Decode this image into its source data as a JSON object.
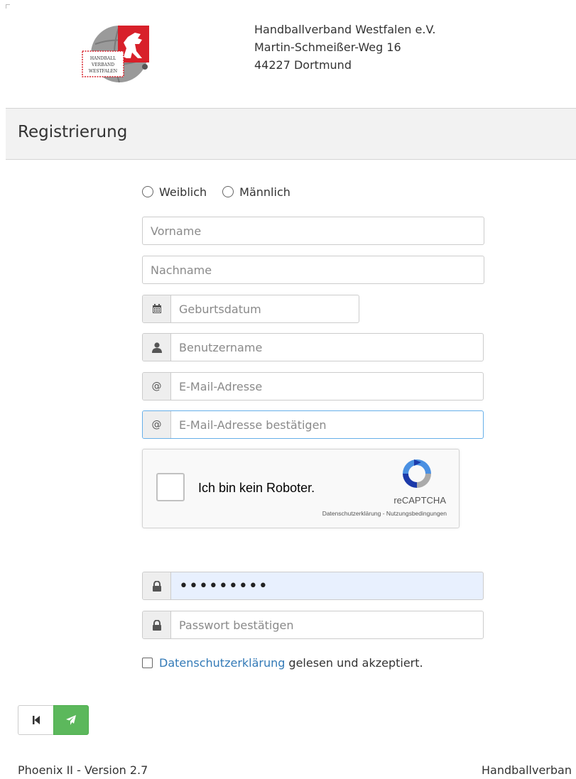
{
  "header": {
    "logo_text": [
      "HANDBALL",
      "VERBAND",
      "WESTFALEN"
    ],
    "address_lines": [
      "Handballverband Westfalen e.V.",
      "Martin-Schmeißer-Weg 16",
      "44227 Dortmund"
    ]
  },
  "page_title": "Registrierung",
  "gender": {
    "options": [
      "Weiblich",
      "Männlich"
    ]
  },
  "fields": {
    "first_name": {
      "placeholder": "Vorname"
    },
    "last_name": {
      "placeholder": "Nachname"
    },
    "birthdate": {
      "placeholder": "Geburtsdatum",
      "icon": "calendar-icon"
    },
    "username": {
      "placeholder": "Benutzername",
      "icon": "user-icon"
    },
    "email": {
      "placeholder": "E-Mail-Adresse",
      "icon_text": "@"
    },
    "email_confirm": {
      "placeholder": "E-Mail-Adresse bestätigen",
      "icon_text": "@"
    },
    "password": {
      "value": "•••••••••",
      "icon": "lock-icon"
    },
    "password_confirm": {
      "placeholder": "Passwort bestätigen",
      "icon": "lock-icon"
    }
  },
  "captcha": {
    "label": "Ich bin kein Roboter.",
    "brand": "reCAPTCHA",
    "links": "Datenschutzerklärung - Nutzungsbedingungen"
  },
  "consent": {
    "link_text": "Datenschutzerklärung",
    "rest_text": "gelesen und akzeptiert."
  },
  "buttons": {
    "back_icon": "first-page-icon",
    "send_icon": "paper-plane-icon"
  },
  "footer": {
    "left": "Phoenix II - Version 2.7",
    "right": "Handballverban"
  },
  "colors": {
    "send_button": "#5cb85c",
    "link": "#337ab7",
    "logo_red": "#d8202a",
    "autofill": "#e8f0fe"
  }
}
